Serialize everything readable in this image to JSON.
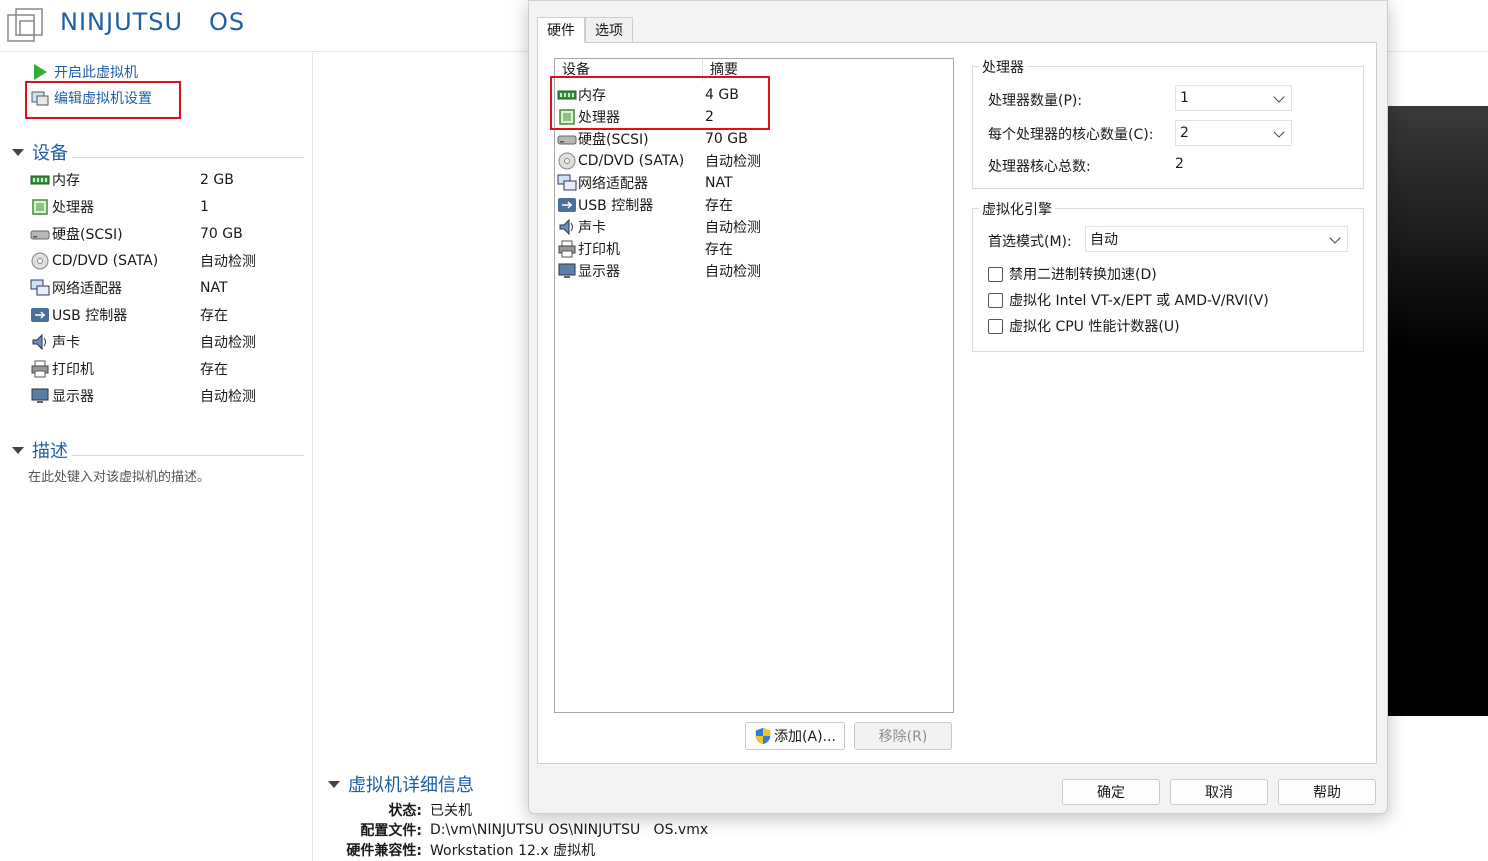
{
  "vm": {
    "title": "NINJUTSU   OS",
    "actions": {
      "power_on": "开启此虚拟机",
      "edit_settings": "编辑虚拟机设置"
    },
    "devices_section": "设备",
    "devices": [
      {
        "name": "内存",
        "value": "2 GB",
        "icon": "memory-icon"
      },
      {
        "name": "处理器",
        "value": "1",
        "icon": "processor-icon"
      },
      {
        "name": "硬盘(SCSI)",
        "value": "70 GB",
        "icon": "hard-disk-icon"
      },
      {
        "name": "CD/DVD (SATA)",
        "value": "自动检测",
        "icon": "cd-dvd-icon"
      },
      {
        "name": "网络适配器",
        "value": "NAT",
        "icon": "network-adapter-icon"
      },
      {
        "name": "USB 控制器",
        "value": "存在",
        "icon": "usb-icon"
      },
      {
        "name": "声卡",
        "value": "自动检测",
        "icon": "sound-card-icon"
      },
      {
        "name": "打印机",
        "value": "存在",
        "icon": "printer-icon"
      },
      {
        "name": "显示器",
        "value": "自动检测",
        "icon": "display-icon"
      }
    ],
    "description_section": "描述",
    "description_placeholder": "在此处键入对该虚拟机的描述。",
    "details_section": "虚拟机详细信息",
    "details": [
      {
        "key": "状态:",
        "value": "已关机"
      },
      {
        "key": "配置文件:",
        "value": "D:\\vm\\NINJUTSU OS\\NINJUTSU   OS.vmx"
      },
      {
        "key": "硬件兼容性:",
        "value": "Workstation 12.x 虚拟机"
      }
    ]
  },
  "dialog": {
    "tabs": [
      "硬件",
      "选项"
    ],
    "list_headers": {
      "device": "设备",
      "summary": "摘要"
    },
    "devices": [
      {
        "name": "内存",
        "summary": "4 GB",
        "icon": "memory-icon"
      },
      {
        "name": "处理器",
        "summary": "2",
        "icon": "processor-icon"
      },
      {
        "name": "硬盘(SCSI)",
        "summary": "70 GB",
        "icon": "hard-disk-icon"
      },
      {
        "name": "CD/DVD (SATA)",
        "summary": "自动检测",
        "icon": "cd-dvd-icon"
      },
      {
        "name": "网络适配器",
        "summary": "NAT",
        "icon": "network-adapter-icon"
      },
      {
        "name": "USB 控制器",
        "summary": "存在",
        "icon": "usb-icon"
      },
      {
        "name": "声卡",
        "summary": "自动检测",
        "icon": "sound-card-icon"
      },
      {
        "name": "打印机",
        "summary": "存在",
        "icon": "printer-icon"
      },
      {
        "name": "显示器",
        "summary": "自动检测",
        "icon": "display-icon"
      }
    ],
    "add_button": "添加(A)...",
    "remove_button": "移除(R)",
    "processor_group": {
      "title": "处理器",
      "count_label": "处理器数量(P):",
      "count_value": "1",
      "cores_label": "每个处理器的核心数量(C):",
      "cores_value": "2",
      "total_label": "处理器核心总数:",
      "total_value": "2"
    },
    "virt_group": {
      "title": "虚拟化引擎",
      "mode_label": "首选模式(M):",
      "mode_value": "自动",
      "opt_binary": "禁用二进制转换加速(D)",
      "opt_vtx": "虚拟化 Intel VT-x/EPT 或 AMD-V/RVI(V)",
      "opt_cpu_counters": "虚拟化 CPU 性能计数器(U)"
    },
    "footer": {
      "ok": "确定",
      "cancel": "取消",
      "help": "帮助"
    }
  },
  "colors": {
    "accent": "#1f5fa8",
    "highlight": "#e0101a"
  }
}
